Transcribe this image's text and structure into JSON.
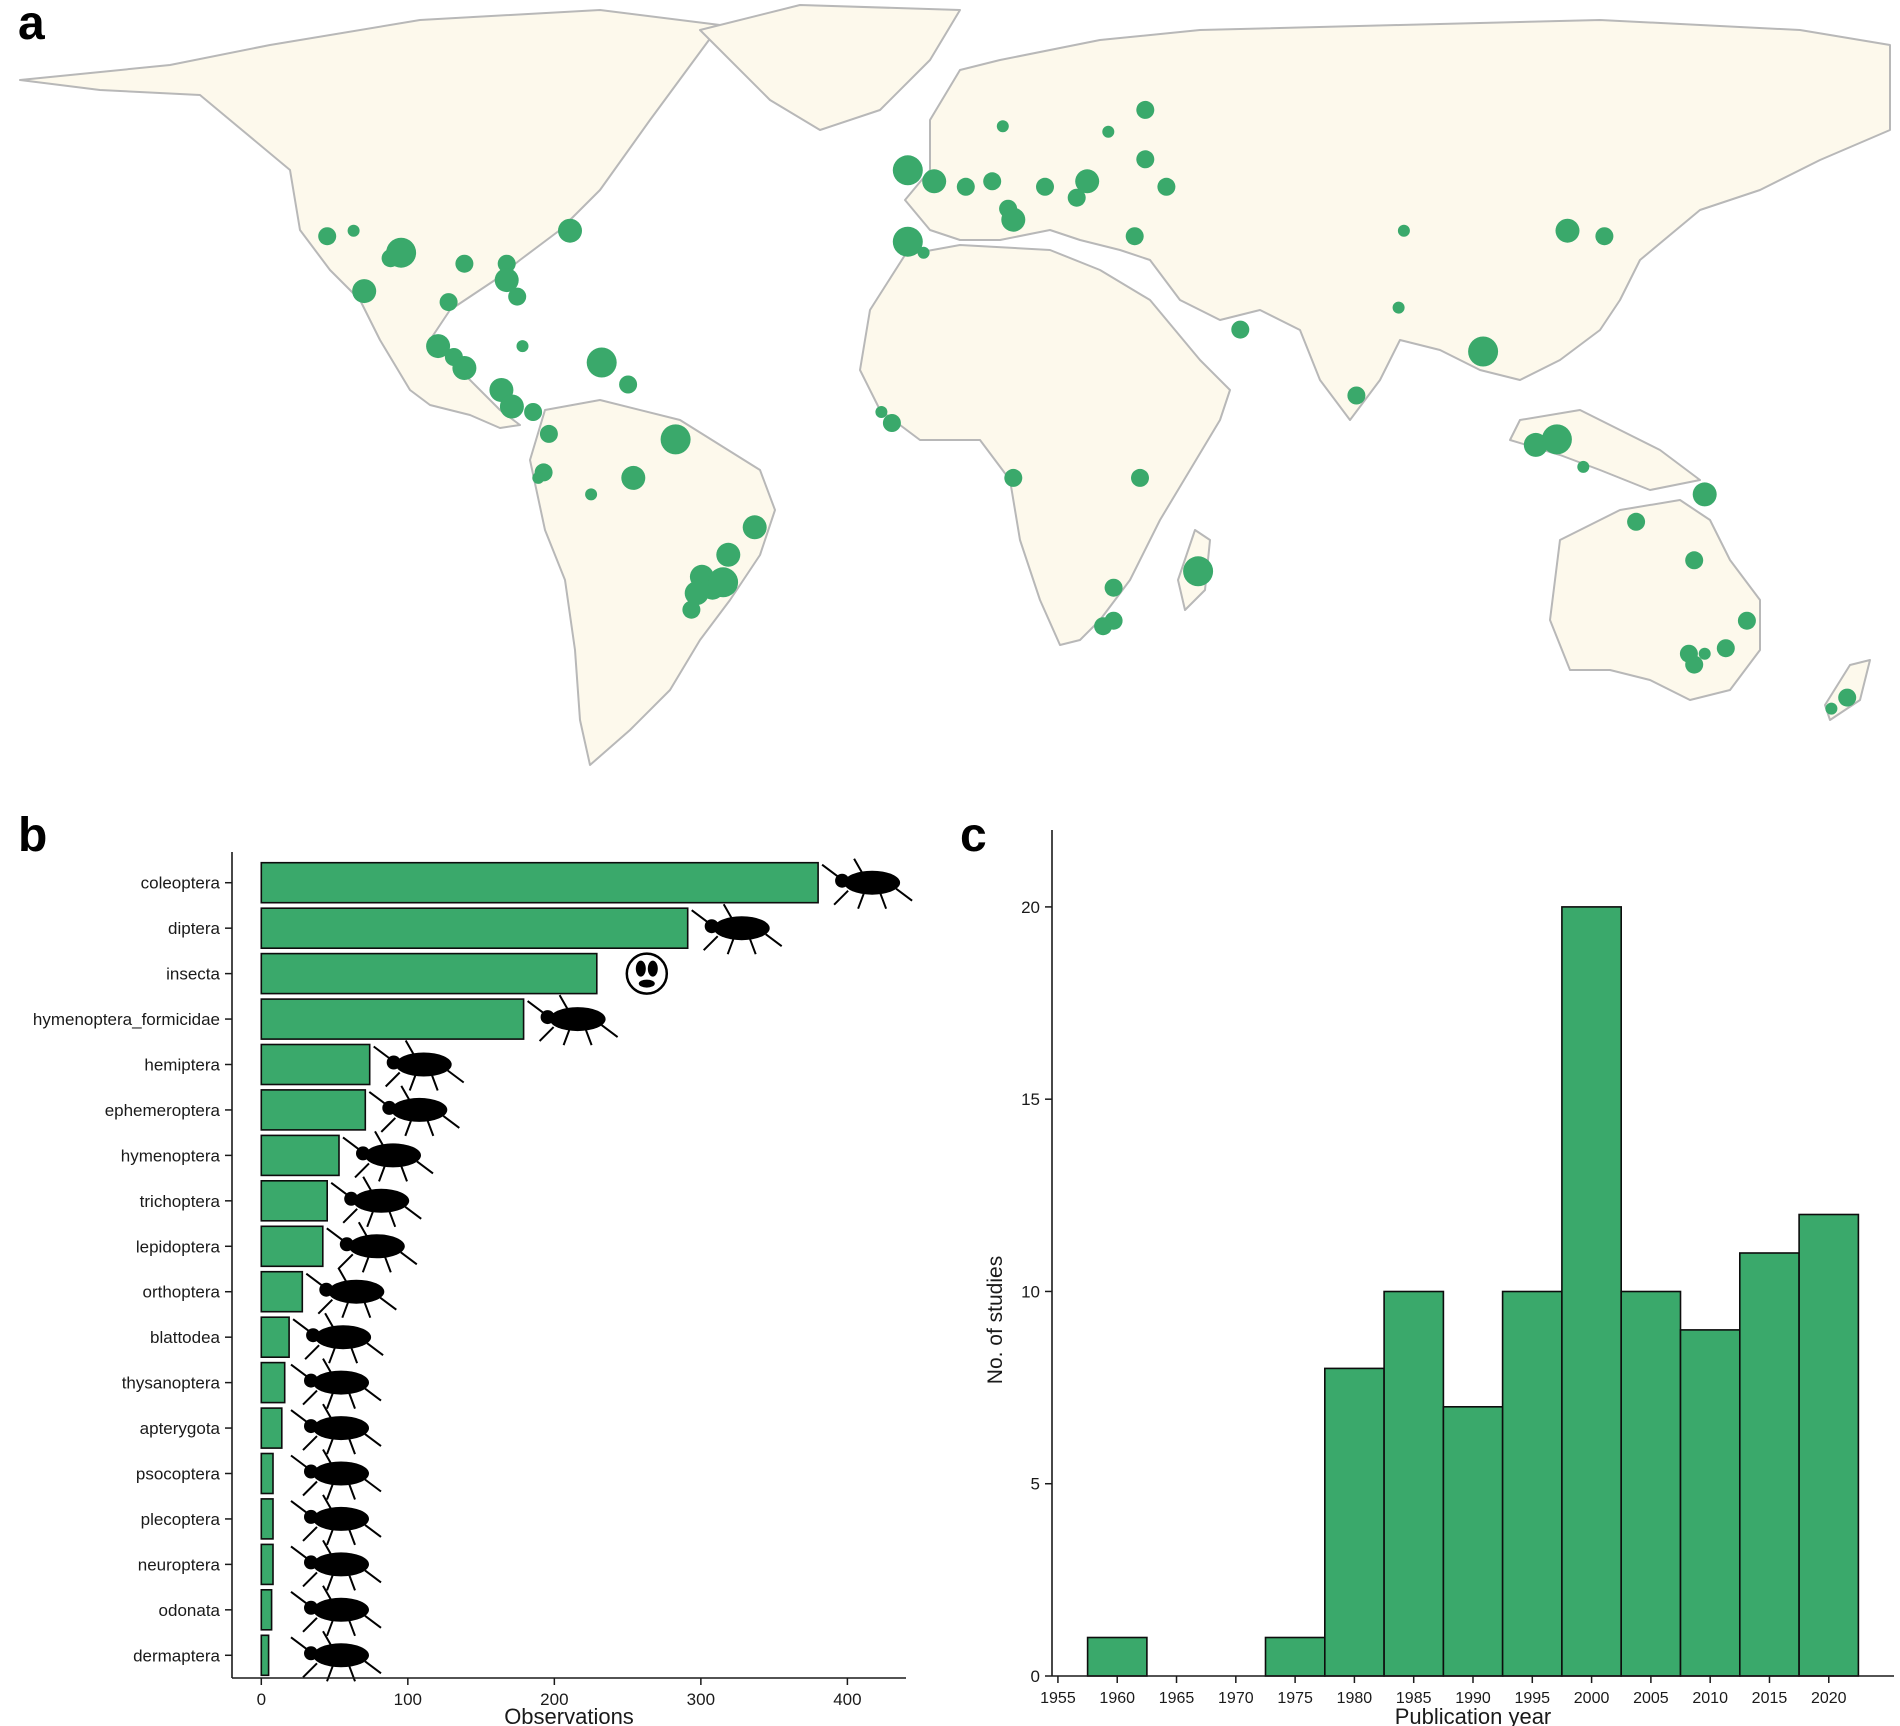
{
  "panels": {
    "a": "a",
    "b": "b",
    "c": "c"
  },
  "colors": {
    "accent": "#3aa96b",
    "bar": "#3aa96b",
    "bar_stroke": "#0d0d0d",
    "land": "#fdf9ec",
    "border": "#b8b8b8",
    "axis": "#1a1a1a"
  },
  "map": {
    "projection": "equirectangular",
    "lon_range": [
      -180,
      180
    ],
    "lat_range": [
      -58,
      84
    ],
    "sites": [
      {
        "lon": -118,
        "lat": 41,
        "size": "small"
      },
      {
        "lon": -113,
        "lat": 42,
        "size": "tiny"
      },
      {
        "lon": -106,
        "lat": 37,
        "size": "small"
      },
      {
        "lon": -104,
        "lat": 38,
        "size": "large"
      },
      {
        "lon": -111,
        "lat": 31,
        "size": "medium"
      },
      {
        "lon": -92,
        "lat": 36,
        "size": "small"
      },
      {
        "lon": -84,
        "lat": 36,
        "size": "small"
      },
      {
        "lon": -84,
        "lat": 33,
        "size": "medium"
      },
      {
        "lon": -82,
        "lat": 30,
        "size": "small"
      },
      {
        "lon": -95,
        "lat": 29,
        "size": "small"
      },
      {
        "lon": -72,
        "lat": 42,
        "size": "medium"
      },
      {
        "lon": -97,
        "lat": 21,
        "size": "medium"
      },
      {
        "lon": -94,
        "lat": 19,
        "size": "small"
      },
      {
        "lon": -92,
        "lat": 17,
        "size": "medium"
      },
      {
        "lon": -85,
        "lat": 13,
        "size": "medium"
      },
      {
        "lon": -83,
        "lat": 10,
        "size": "medium"
      },
      {
        "lon": -79,
        "lat": 9,
        "size": "small"
      },
      {
        "lon": -76,
        "lat": 5,
        "size": "small"
      },
      {
        "lon": -81,
        "lat": 21,
        "size": "tiny"
      },
      {
        "lon": -66,
        "lat": 18,
        "size": "large"
      },
      {
        "lon": -61,
        "lat": 14,
        "size": "small"
      },
      {
        "lon": -52,
        "lat": 4,
        "size": "large"
      },
      {
        "lon": -60,
        "lat": -3,
        "size": "medium"
      },
      {
        "lon": -77,
        "lat": -2,
        "size": "small"
      },
      {
        "lon": -78,
        "lat": -3,
        "size": "tiny"
      },
      {
        "lon": -68,
        "lat": -6,
        "size": "tiny"
      },
      {
        "lon": -37,
        "lat": -12,
        "size": "medium"
      },
      {
        "lon": -42,
        "lat": -17,
        "size": "medium"
      },
      {
        "lon": -47,
        "lat": -21,
        "size": "medium"
      },
      {
        "lon": -45,
        "lat": -23,
        "size": "medium"
      },
      {
        "lon": -43,
        "lat": -22,
        "size": "large"
      },
      {
        "lon": -48,
        "lat": -24,
        "size": "medium"
      },
      {
        "lon": -49,
        "lat": -27,
        "size": "small"
      },
      {
        "lon": -8,
        "lat": 53,
        "size": "large"
      },
      {
        "lon": -3,
        "lat": 51,
        "size": "medium"
      },
      {
        "lon": 3,
        "lat": 50,
        "size": "small"
      },
      {
        "lon": 8,
        "lat": 51,
        "size": "small"
      },
      {
        "lon": 10,
        "lat": 61,
        "size": "tiny"
      },
      {
        "lon": 11,
        "lat": 46,
        "size": "small"
      },
      {
        "lon": 12,
        "lat": 44,
        "size": "medium"
      },
      {
        "lon": 18,
        "lat": 50,
        "size": "small"
      },
      {
        "lon": 24,
        "lat": 48,
        "size": "small"
      },
      {
        "lon": 26,
        "lat": 51,
        "size": "medium"
      },
      {
        "lon": 30,
        "lat": 60,
        "size": "tiny"
      },
      {
        "lon": 37,
        "lat": 64,
        "size": "small"
      },
      {
        "lon": 37,
        "lat": 55,
        "size": "small"
      },
      {
        "lon": 41,
        "lat": 50,
        "size": "small"
      },
      {
        "lon": 35,
        "lat": 41,
        "size": "small"
      },
      {
        "lon": -8,
        "lat": 40,
        "size": "large"
      },
      {
        "lon": -5,
        "lat": 38,
        "size": "tiny"
      },
      {
        "lon": -13,
        "lat": 9,
        "size": "tiny"
      },
      {
        "lon": -11,
        "lat": 7,
        "size": "small"
      },
      {
        "lon": 12,
        "lat": -3,
        "size": "small"
      },
      {
        "lon": 36,
        "lat": -3,
        "size": "small"
      },
      {
        "lon": 47,
        "lat": -20,
        "size": "large"
      },
      {
        "lon": 31,
        "lat": -23,
        "size": "small"
      },
      {
        "lon": 29,
        "lat": -30,
        "size": "small"
      },
      {
        "lon": 31,
        "lat": -29,
        "size": "small"
      },
      {
        "lon": 55,
        "lat": 24,
        "size": "small"
      },
      {
        "lon": 86,
        "lat": 42,
        "size": "tiny"
      },
      {
        "lon": 117,
        "lat": 42,
        "size": "medium"
      },
      {
        "lon": 124,
        "lat": 41,
        "size": "small"
      },
      {
        "lon": 85,
        "lat": 28,
        "size": "tiny"
      },
      {
        "lon": 77,
        "lat": 12,
        "size": "small"
      },
      {
        "lon": 101,
        "lat": 20,
        "size": "large"
      },
      {
        "lon": 111,
        "lat": 3,
        "size": "medium"
      },
      {
        "lon": 115,
        "lat": 4,
        "size": "large"
      },
      {
        "lon": 120,
        "lat": -1,
        "size": "tiny"
      },
      {
        "lon": 143,
        "lat": -6,
        "size": "medium"
      },
      {
        "lon": 130,
        "lat": -11,
        "size": "small"
      },
      {
        "lon": 141,
        "lat": -18,
        "size": "small"
      },
      {
        "lon": 151,
        "lat": -29,
        "size": "small"
      },
      {
        "lon": 147,
        "lat": -34,
        "size": "small"
      },
      {
        "lon": 140,
        "lat": -35,
        "size": "small"
      },
      {
        "lon": 143,
        "lat": -35,
        "size": "tiny"
      },
      {
        "lon": 141,
        "lat": -37,
        "size": "small"
      },
      {
        "lon": 170,
        "lat": -43,
        "size": "small"
      },
      {
        "lon": 167,
        "lat": -45,
        "size": "tiny"
      }
    ]
  },
  "chart_data": [
    {
      "type": "bar",
      "orientation": "horizontal",
      "categories": [
        "coleoptera",
        "diptera",
        "insecta",
        "hymenoptera_formicidae",
        "hemiptera",
        "ephemeroptera",
        "hymenoptera",
        "trichoptera",
        "lepidoptera",
        "orthoptera",
        "blattodea",
        "thysanoptera",
        "apterygota",
        "psocoptera",
        "plecoptera",
        "neuroptera",
        "odonata",
        "dermaptera"
      ],
      "values": [
        380,
        291,
        229,
        179,
        74,
        71,
        53,
        45,
        42,
        28,
        19,
        16,
        14,
        8,
        8,
        8,
        7,
        5
      ],
      "icons": [
        "beetle-icon",
        "fly-icon",
        "insect-logo-icon",
        "ant-icon",
        "bug-icon",
        "mayfly-icon",
        "bee-icon",
        "caddisfly-icon",
        "butterfly-icon",
        "grasshopper-icon",
        "cockroach-icon",
        "thrips-icon",
        "silverfish-icon",
        "booklouse-icon",
        "stonefly-icon",
        "lacewing-icon",
        "dragonfly-icon",
        "earwig-icon"
      ],
      "xlabel": "Observations",
      "ylabel": "",
      "xlim": [
        -20,
        440
      ],
      "xticks": [
        0,
        100,
        200,
        300,
        400
      ],
      "grid": false
    },
    {
      "type": "bar",
      "subtype": "histogram",
      "bin_width": 5,
      "bins": [
        {
          "center": 1960,
          "count": 1
        },
        {
          "center": 1965,
          "count": 0
        },
        {
          "center": 1970,
          "count": 0
        },
        {
          "center": 1975,
          "count": 1
        },
        {
          "center": 1980,
          "count": 8
        },
        {
          "center": 1985,
          "count": 10
        },
        {
          "center": 1990,
          "count": 7
        },
        {
          "center": 1995,
          "count": 10
        },
        {
          "center": 2000,
          "count": 20
        },
        {
          "center": 2005,
          "count": 10
        },
        {
          "center": 2010,
          "count": 9
        },
        {
          "center": 2015,
          "count": 11
        },
        {
          "center": 2020,
          "count": 12
        }
      ],
      "xlabel": "Publication year",
      "ylabel": "No. of studies",
      "xlim": [
        1954.5,
        2025.5
      ],
      "ylim": [
        0,
        22
      ],
      "xticks": [
        1955,
        1960,
        1965,
        1970,
        1975,
        1980,
        1985,
        1990,
        1995,
        2000,
        2005,
        2010,
        2015,
        2020
      ],
      "yticks": [
        0,
        5,
        10,
        15,
        20
      ],
      "grid": false
    }
  ]
}
